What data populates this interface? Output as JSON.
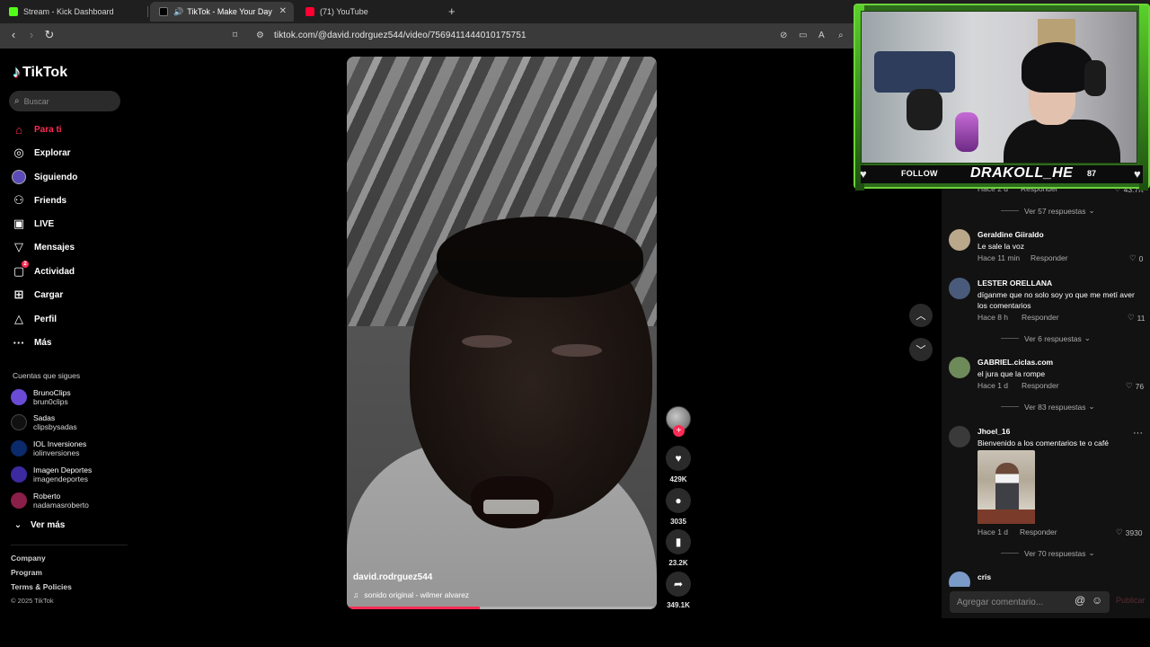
{
  "browser": {
    "tabs": [
      {
        "title": "Stream - Kick Dashboard",
        "favicon_color": "#53fc18",
        "active": false
      },
      {
        "title": "TikTok - Make Your Day",
        "favicon_color": "#ffffff",
        "active": true
      },
      {
        "title": "(71) YouTube",
        "favicon_color": "#ff0033",
        "active": false
      }
    ],
    "new_tab_label": "+",
    "url": "tiktok.com/@david.rodrguez544/video/7569411444010175751"
  },
  "tiktok": {
    "brand": "TikTok",
    "search_placeholder": "Buscar",
    "nav": [
      {
        "label": "Para ti",
        "icon": "home-icon",
        "active": true
      },
      {
        "label": "Explorar",
        "icon": "compass-icon",
        "active": false
      },
      {
        "label": "Siguiendo",
        "icon": "following-avatar-icon",
        "active": false
      },
      {
        "label": "Friends",
        "icon": "friends-icon",
        "active": false
      },
      {
        "label": "LIVE",
        "icon": "live-icon",
        "active": false
      },
      {
        "label": "Mensajes",
        "icon": "messages-icon",
        "active": false
      },
      {
        "label": "Actividad",
        "icon": "activity-icon",
        "active": false,
        "badge": "2"
      },
      {
        "label": "Cargar",
        "icon": "upload-icon",
        "active": false
      },
      {
        "label": "Perfil",
        "icon": "profile-icon",
        "active": false
      },
      {
        "label": "Más",
        "icon": "more-icon",
        "active": false
      }
    ],
    "following_title": "Cuentas que sigues",
    "following": [
      {
        "name": "BrunoClips",
        "handle": "brun0clips",
        "avatar_color": "#6a4bd6"
      },
      {
        "name": "Sadas",
        "handle": "clipsbysadas",
        "avatar_color": "#111111"
      },
      {
        "name": "IOL Inversiones",
        "handle": "iolinversiones",
        "avatar_color": "#0b2a6b"
      },
      {
        "name": "Imagen Deportes",
        "handle": "imagendeportes",
        "avatar_color": "#3b2aa0"
      },
      {
        "name": "Roberto",
        "handle": "nadamasroberto",
        "avatar_color": "#8a1f4a"
      }
    ],
    "see_more": "Ver más",
    "footer": [
      "Company",
      "Program",
      "Terms & Policies"
    ],
    "copyright": "© 2025 TikTok"
  },
  "video": {
    "username": "david.rodrguez544",
    "sound": "sonido original - wilmer alvarez",
    "progress": 0.43,
    "likes": "429K",
    "comments": "3035",
    "saves": "23.2K",
    "shares": "349.1K"
  },
  "comments": {
    "top_partial": {
      "meta": "Hace 2 d",
      "reply": "Responder",
      "likes": "43.7K",
      "replies": "Ver 57 respuestas"
    },
    "items": [
      {
        "user": "Geraldine Giiraldo",
        "text": "Le sale la voz",
        "meta": "Hace 11 min",
        "reply": "Responder",
        "likes": "0",
        "avatar_color": "#b9a88a"
      },
      {
        "user": "LESTER ORELLANA",
        "text": "díganme que no solo soy yo que me metí aver los comentarios",
        "meta": "Hace 8 h",
        "reply": "Responder",
        "likes": "11",
        "replies": "Ver 6 respuestas",
        "avatar_color": "#4a5a7a"
      },
      {
        "user": "GABRIEL.ciclas.com",
        "text": "el jura que la rompe",
        "meta": "Hace 1 d",
        "reply": "Responder",
        "likes": "76",
        "replies": "Ver 83 respuestas",
        "avatar_color": "#6f8a5a"
      },
      {
        "user": "Jhoel_16",
        "text": "Bienvenido a los comentarios te o café",
        "meta": "Hace 1 d",
        "reply": "Responder",
        "likes": "3930",
        "replies": "Ver 70 respuestas",
        "avatar_color": "#3a3a3a"
      },
      {
        "user": "cris",
        "avatar_color": "#7a9ac8"
      }
    ],
    "input_placeholder": "Agregar comentario...",
    "publish": "Publicar"
  },
  "stream_overlay": {
    "follow_label": "FOLLOW",
    "streamer_name": "DRAKOLL_HE",
    "count": "87",
    "accent": "#6cd43a"
  }
}
